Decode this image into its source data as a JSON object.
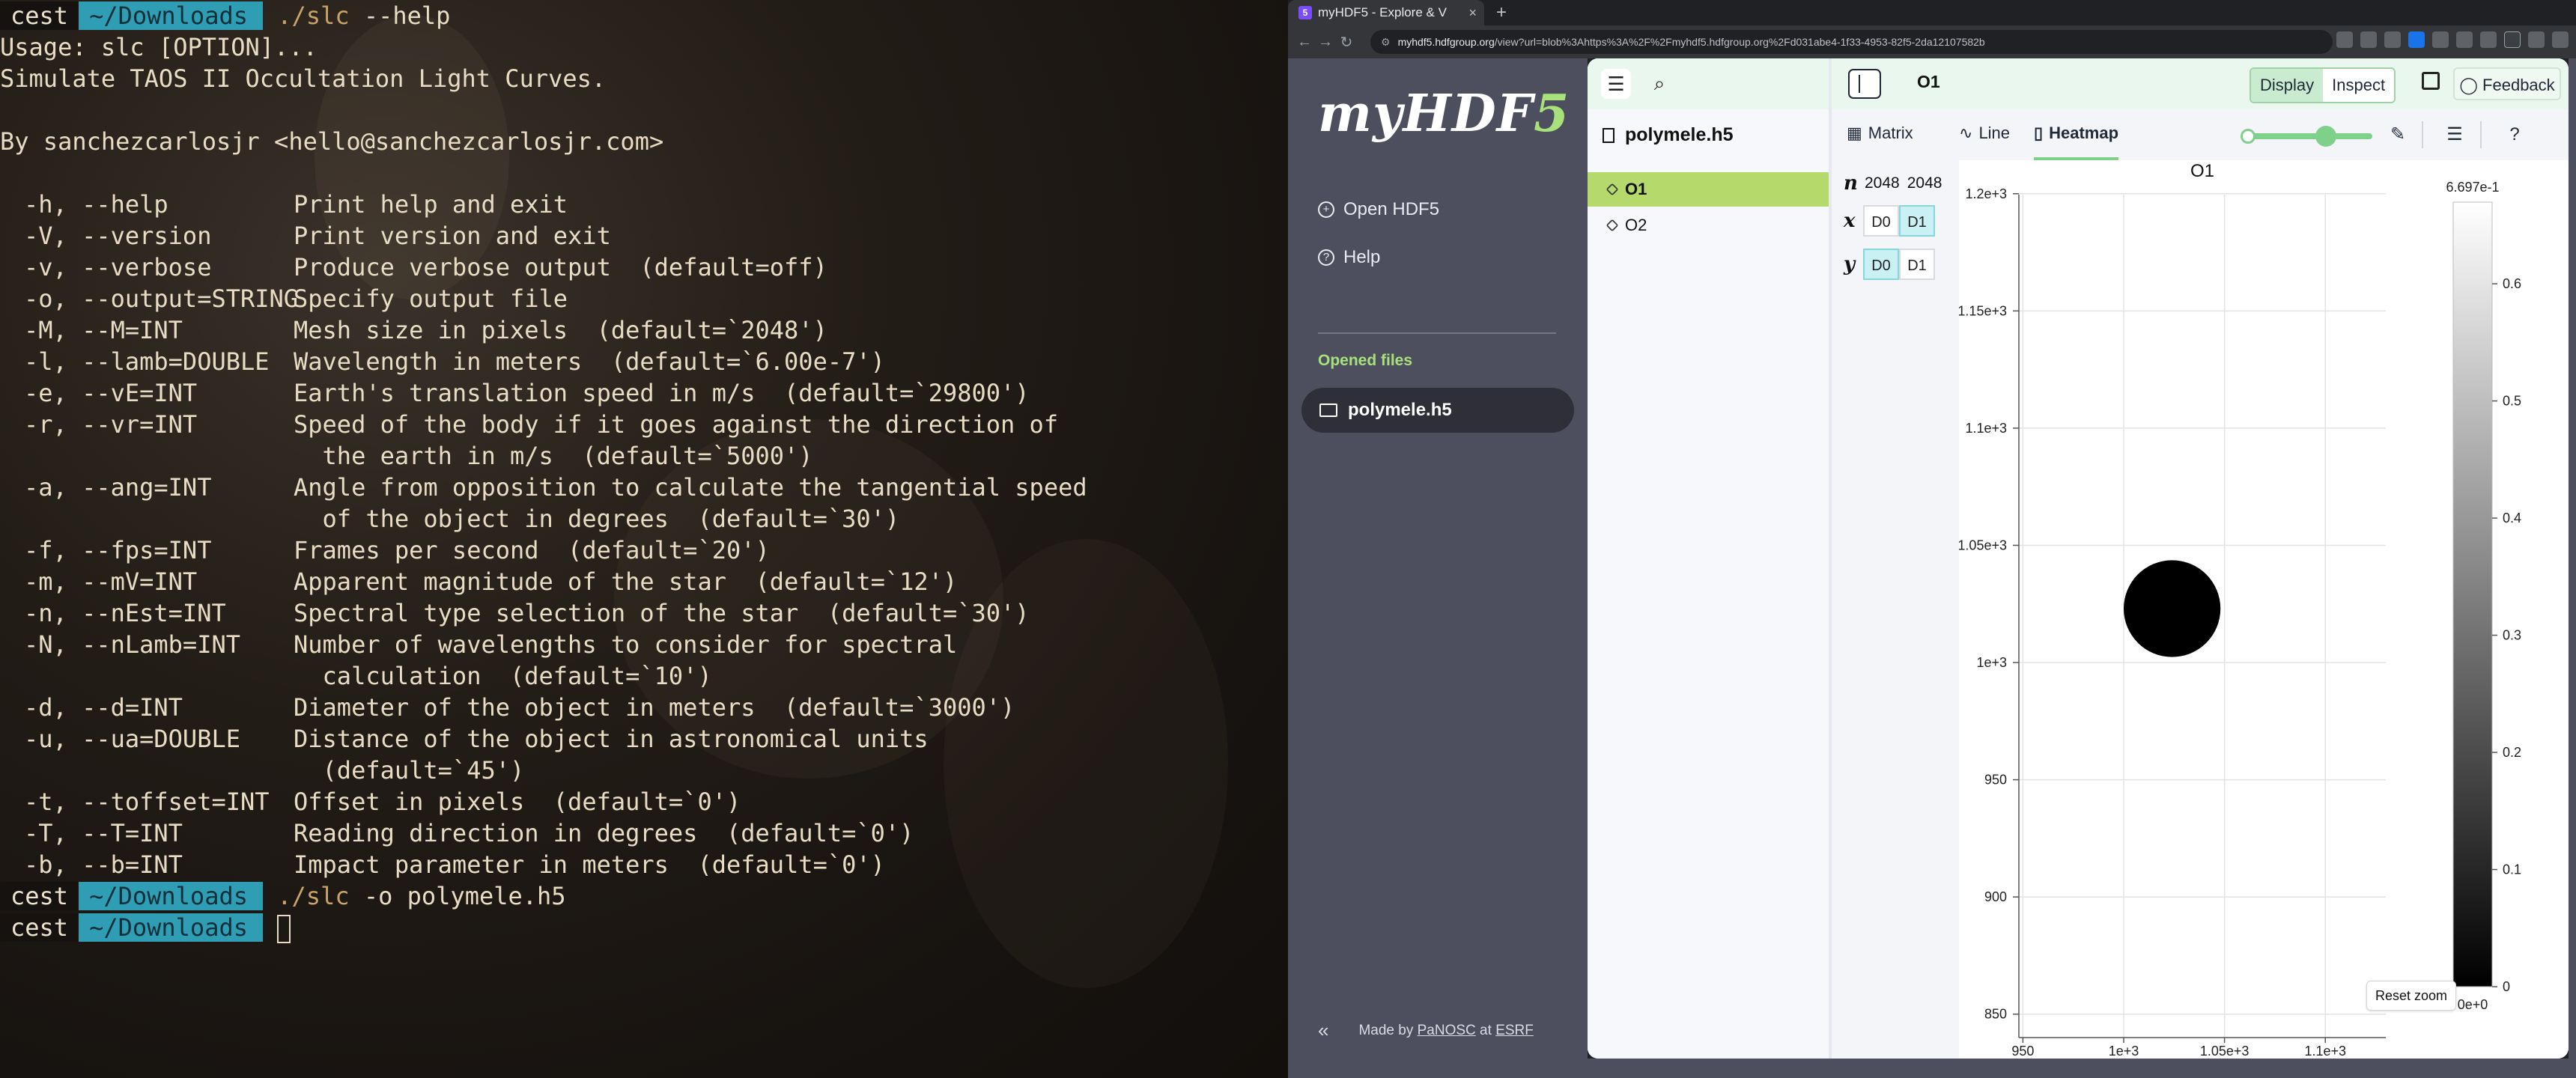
{
  "terminal": {
    "lines": [
      {
        "type": "prompt",
        "host": "cest",
        "dir": "~/Downloads",
        "exe": "./slc",
        "args": " --help"
      },
      {
        "type": "text",
        "text": "Usage: slc [OPTION]..."
      },
      {
        "type": "text",
        "text": "Simulate TAOS II Occultation Light Curves."
      },
      {
        "type": "text",
        "text": ""
      },
      {
        "type": "text",
        "text": "By sanchezcarlosjr <hello@sanchezcarlosjr.com>"
      },
      {
        "type": "text",
        "text": ""
      },
      {
        "type": "opt",
        "opt": "-h, --help",
        "desc": "Print help and exit"
      },
      {
        "type": "opt",
        "opt": "-V, --version",
        "desc": "Print version and exit"
      },
      {
        "type": "opt",
        "opt": "-v, --verbose",
        "desc": "Produce verbose output  (default=off)"
      },
      {
        "type": "opt",
        "opt": "-o, --output=STRING",
        "desc": "Specify output file"
      },
      {
        "type": "opt",
        "opt": "-M, --M=INT",
        "desc": "Mesh size in pixels  (default=`2048')"
      },
      {
        "type": "opt",
        "opt": "-l, --lamb=DOUBLE",
        "desc": "Wavelength in meters  (default=`6.00e-7')"
      },
      {
        "type": "opt",
        "opt": "-e, --vE=INT",
        "desc": "Earth's translation speed in m/s  (default=`29800')"
      },
      {
        "type": "opt",
        "opt": "-r, --vr=INT",
        "desc": "Speed of the body if it goes against the direction of"
      },
      {
        "type": "opt",
        "opt": "",
        "desc": "  the earth in m/s  (default=`5000')"
      },
      {
        "type": "opt",
        "opt": "-a, --ang=INT",
        "desc": "Angle from opposition to calculate the tangential speed"
      },
      {
        "type": "opt",
        "opt": "",
        "desc": "  of the object in degrees  (default=`30')"
      },
      {
        "type": "opt",
        "opt": "-f, --fps=INT",
        "desc": "Frames per second  (default=`20')"
      },
      {
        "type": "opt",
        "opt": "-m, --mV=INT",
        "desc": "Apparent magnitude of the star  (default=`12')"
      },
      {
        "type": "opt",
        "opt": "-n, --nEst=INT",
        "desc": "Spectral type selection of the star  (default=`30')"
      },
      {
        "type": "opt",
        "opt": "-N, --nLamb=INT",
        "desc": "Number of wavelengths to consider for spectral"
      },
      {
        "type": "opt",
        "opt": "",
        "desc": "  calculation  (default=`10')"
      },
      {
        "type": "opt",
        "opt": "-d, --d=INT",
        "desc": "Diameter of the object in meters  (default=`3000')"
      },
      {
        "type": "opt",
        "opt": "-u, --ua=DOUBLE",
        "desc": "Distance of the object in astronomical units"
      },
      {
        "type": "opt",
        "opt": "",
        "desc": "  (default=`45')"
      },
      {
        "type": "opt",
        "opt": "-t, --toffset=INT",
        "desc": "Offset in pixels  (default=`0')"
      },
      {
        "type": "opt",
        "opt": "-T, --T=INT",
        "desc": "Reading direction in degrees  (default=`0')"
      },
      {
        "type": "opt",
        "opt": "-b, --b=INT",
        "desc": "Impact parameter in meters  (default=`0')"
      },
      {
        "type": "prompt",
        "host": "cest",
        "dir": "~/Downloads",
        "exe": "./slc",
        "args": " -o polymele.h5"
      },
      {
        "type": "prompt",
        "host": "cest",
        "dir": "~/Downloads",
        "exe": "",
        "args": "",
        "cursor": true
      }
    ],
    "colors": {
      "text": "#e8dcc4",
      "dir_bg": "#2f9db4",
      "exe": "#c8a36a"
    }
  },
  "browser": {
    "tab_title": "myHDF5 - Explore & V",
    "new_tab": "+",
    "url_host": "myhdf5.hdfgroup.org",
    "url_rest": "/view?url=blob%3Ahttps%3A%2F%2Fmyhdf5.hdfgroup.org%2Fd031abe4-1f33-4953-82f5-2da12107582b"
  },
  "app": {
    "logo_main": "myHDF",
    "logo_accent": "5",
    "side": {
      "open_hdf5": "Open HDF5",
      "help": "Help",
      "opened_files_label": "Opened files",
      "opened_file": "polymele.h5",
      "footer_prefix": "Made by",
      "footer_link1": "PaNOSC",
      "footer_at": "at",
      "footer_link2": "ESRF"
    },
    "explorer": {
      "file": "polymele.h5",
      "items": [
        {
          "label": "O1",
          "selected": true
        },
        {
          "label": "O2",
          "selected": false
        }
      ]
    },
    "header": {
      "path": "O1",
      "display": "Display",
      "inspect": "Inspect",
      "feedback": "Feedback"
    },
    "tabs": {
      "matrix": "Matrix",
      "line": "Line",
      "heatmap": "Heatmap",
      "active": "Heatmap"
    },
    "dims": {
      "n_label": "n",
      "n_values": [
        "2048",
        "2048"
      ],
      "x_label": "x",
      "y_label": "y",
      "x_buttons": [
        {
          "label": "D0",
          "on": false
        },
        {
          "label": "D1",
          "on": true
        }
      ],
      "y_buttons": [
        {
          "label": "D0",
          "on": true
        },
        {
          "label": "D1",
          "on": false
        }
      ]
    },
    "heatmap": {
      "title": "O1",
      "reset_zoom": "Reset zoom",
      "colorbar_max_label": "6.697e-1",
      "colorbar_min_label": "0e+0",
      "colormap": "greys",
      "colors": {
        "accent": "#a8e07c",
        "selected": "#b6d96b",
        "tab_underline": "#7fd08b",
        "toggle_on": "#c9f1f4"
      }
    }
  },
  "chart_data": {
    "type": "heatmap",
    "title": "O1",
    "x_ticks": [
      "950",
      "1e+3",
      "1.05e+3",
      "1.1e+3"
    ],
    "x_tick_values": [
      950,
      1000,
      1050,
      1100
    ],
    "y_ticks": [
      "850",
      "900",
      "950",
      "1e+3",
      "1.05e+3",
      "1.1e+3",
      "1.15e+3",
      "1.2e+3"
    ],
    "y_tick_values": [
      850,
      900,
      950,
      1000,
      1050,
      1100,
      1150,
      1200
    ],
    "xlim": [
      948,
      1130
    ],
    "ylim": [
      840,
      1206
    ],
    "grid": true,
    "colorbar_ticks": [
      "0.6",
      "0.5",
      "0.4",
      "0.3",
      "0.2",
      "0.1",
      "0"
    ],
    "colorbar_tick_values": [
      0.6,
      0.5,
      0.4,
      0.3,
      0.2,
      0.1,
      0
    ],
    "colorbar_range": [
      0,
      0.6697
    ],
    "background_value": 0.6697,
    "disk": {
      "cx": 1024,
      "cy": 1023,
      "r": 24,
      "value": 0
    }
  }
}
